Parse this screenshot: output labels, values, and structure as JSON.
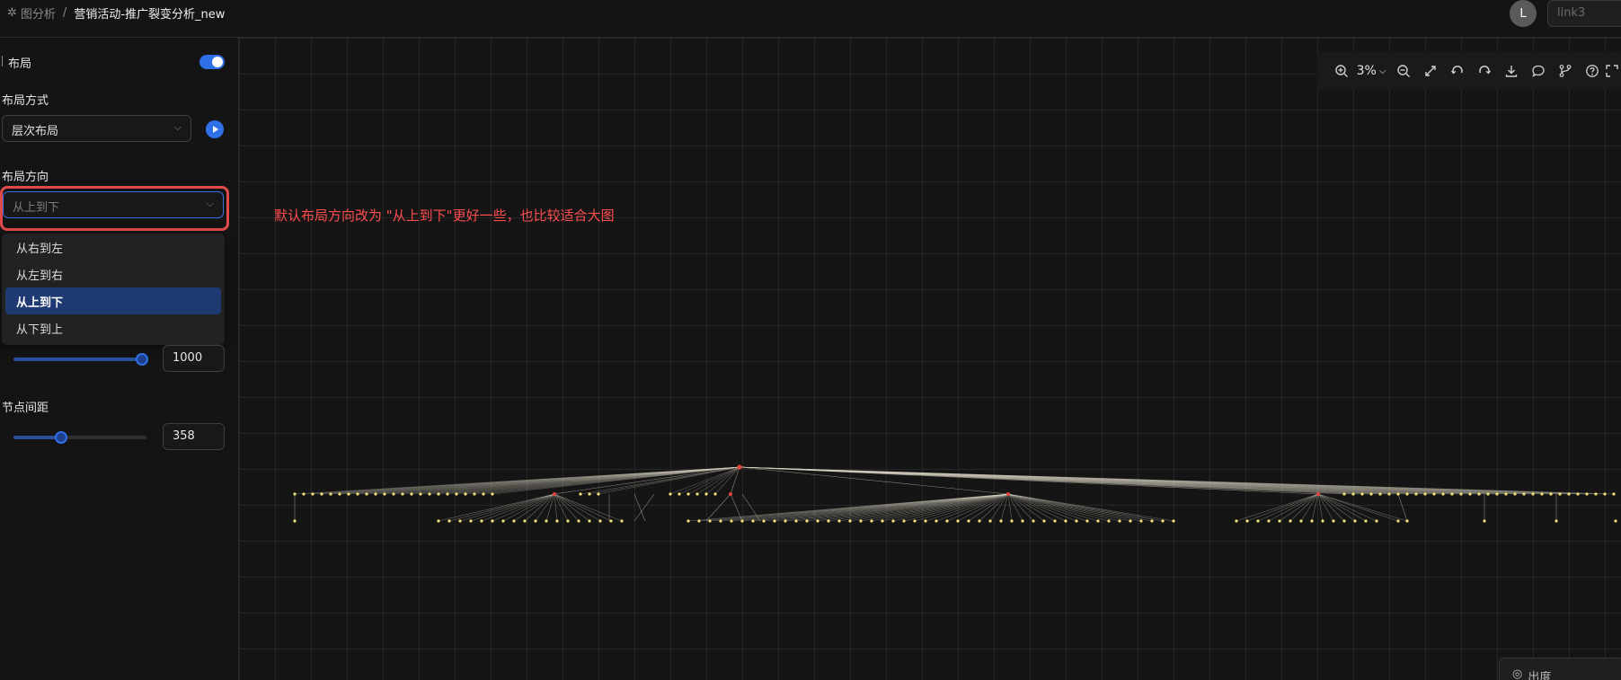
{
  "header": {
    "root_label": "图分析",
    "separator": "/",
    "current_label": "营销活动-推广裂变分析_new",
    "avatar_letter": "L",
    "search_placeholder": "link3"
  },
  "sidebar": {
    "layout_label": "布局",
    "layout_enabled": true,
    "layout_mode_label": "布局方式",
    "layout_mode_value": "层次布局",
    "direction_label": "布局方向",
    "direction_value": "从上到下",
    "direction_options": [
      "从右到左",
      "从左到右",
      "从上到下",
      "从下到上"
    ],
    "selected_option_index": 2,
    "level_spacing_value": "1000",
    "level_spacing_fraction": 1.0,
    "node_spacing_label": "节点间距",
    "node_spacing_value": "358",
    "node_spacing_fraction": 0.36
  },
  "canvas": {
    "annotation": "默认布局方向改为 \"从上到下\"更好一些，也比较适合大图",
    "zoom_label": "3%",
    "toolbar_icons": [
      "zoom-in-icon",
      "zoom-out-icon",
      "fit-view-icon",
      "undo-icon",
      "redo-icon",
      "download-icon",
      "comment-icon",
      "branch-icon",
      "help-icon",
      "expand-icon"
    ],
    "legend_label": "出度",
    "colors": {
      "accent": "#2f6fe8",
      "root_node": "#e8413c",
      "leaf_node": "#f2e27a",
      "edge": "#d8d2c0",
      "annotation": "#ff4d4f"
    }
  }
}
